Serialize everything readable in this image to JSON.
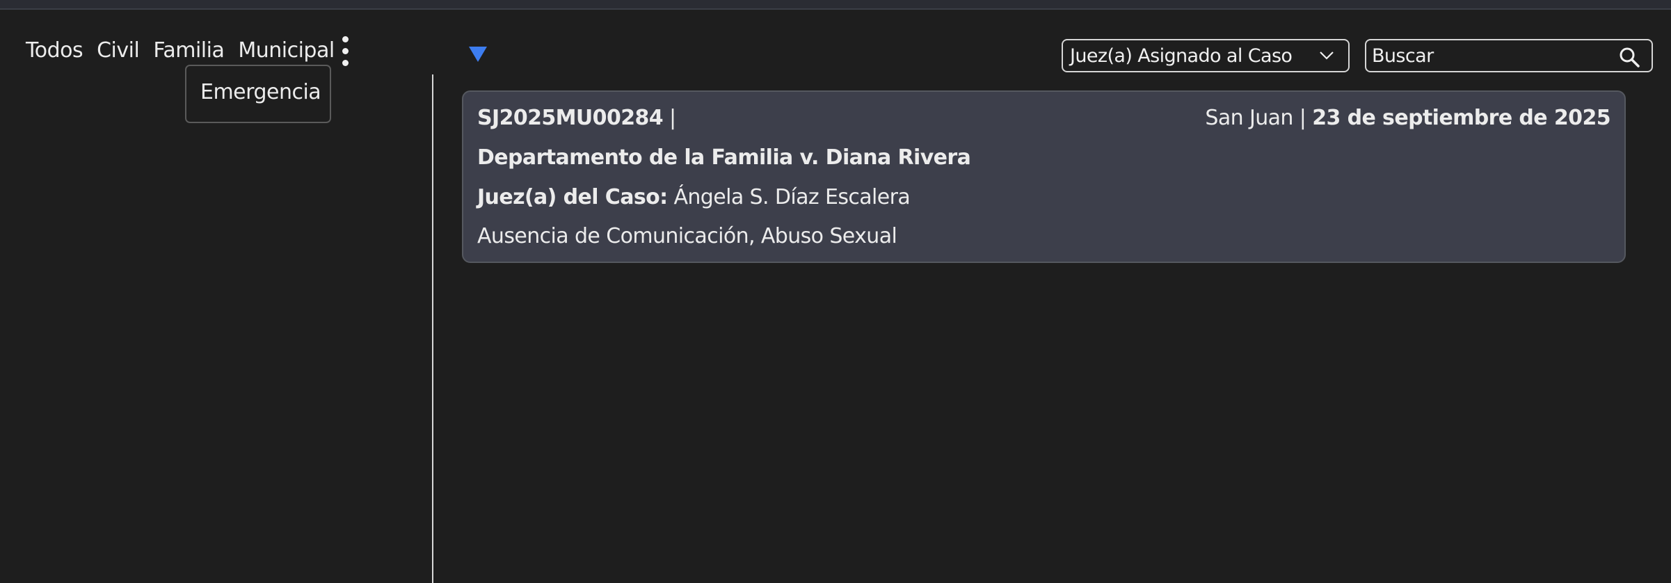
{
  "tabs": [
    {
      "label": "Todos"
    },
    {
      "label": "Civil"
    },
    {
      "label": "Familia"
    },
    {
      "label": "Municipal"
    }
  ],
  "overflow_menu": {
    "items": [
      {
        "label": "Emergencia"
      }
    ]
  },
  "filters": {
    "judge_select_value": "Juez(a) Asignado al Caso",
    "search_placeholder": "Buscar"
  },
  "case": {
    "number": "SJ2025MU00284",
    "separator": "|",
    "location": "San Juan",
    "date_separator": "|",
    "date": "23 de septiembre de 2025",
    "title": "Departamento de la Familia v. Diana Rivera",
    "judge_label": "Juez(a) del Caso:",
    "judge_name": "Ángela S. Díaz Escalera",
    "categories": "Ausencia de Comunicación, Abuso Sexual"
  },
  "colors": {
    "background": "#1e1e1e",
    "card_background": "#3d3f4b",
    "accent": "#3d7df0"
  },
  "icons": {
    "overflow": "kebab-menu-icon",
    "filter_toggle": "triangle-down-icon",
    "select_chevron": "chevron-down-icon",
    "search": "search-icon"
  }
}
